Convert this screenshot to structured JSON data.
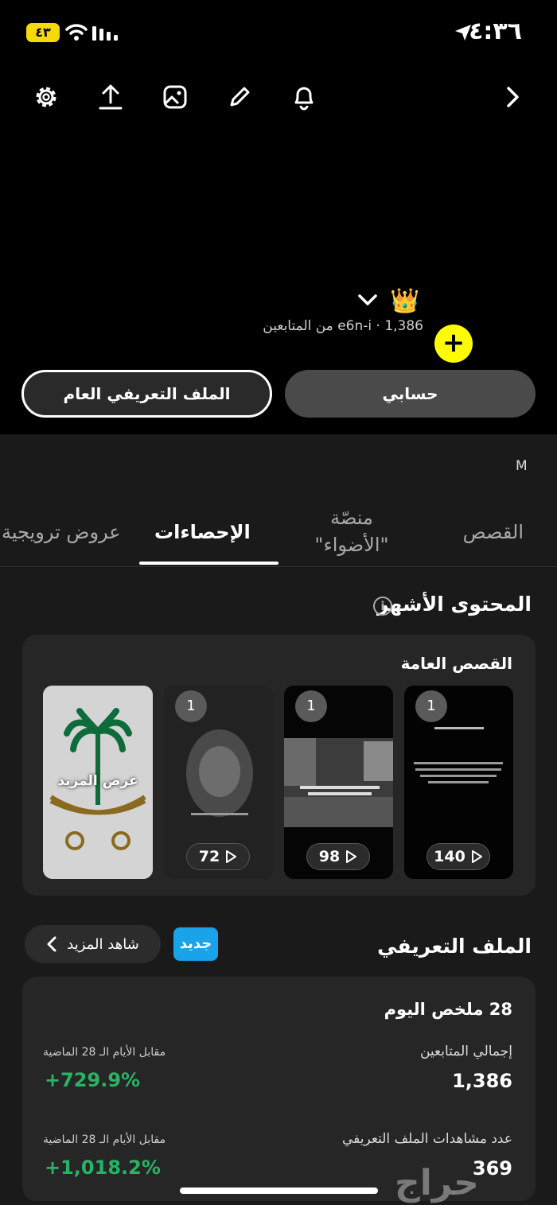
{
  "status_bar": {
    "time": "٤:٣٦",
    "battery": "٤٣"
  },
  "profile": {
    "crown_emoji": "👑",
    "handle_line": "e6n-i · 1,386 من المتابعين",
    "add_symbol": "+"
  },
  "buttons": {
    "public_profile": "الملف التعريفي العام",
    "my_account": "حسابي"
  },
  "tabs_row": {
    "m_label": "M",
    "tabs": [
      {
        "label": "القصص"
      },
      {
        "label": "منصّة \"الأضواء\""
      },
      {
        "label": "الإحصاءات"
      },
      {
        "label": "عروض ترويجية"
      }
    ]
  },
  "top_content": {
    "title": "المحتوى الأشهر",
    "info_glyph": "i",
    "card_title": "القصص العامة",
    "stories": [
      {
        "count": "1",
        "views": "140"
      },
      {
        "count": "1",
        "views": "98"
      },
      {
        "count": "1",
        "views": "72"
      }
    ],
    "see_more_label": "عرض المزيد"
  },
  "profile_section": {
    "title": "الملف التعريفي",
    "new_badge": "جديد",
    "see_more": "شاهد المزيد",
    "summary_title": "28 ملخص اليوم",
    "stats": [
      {
        "label": "إجمالي المتابعين",
        "value": "1,386",
        "compare_label": "مقابل الأيام الـ 28 الماضية",
        "change": "+729.9%"
      },
      {
        "label": "عدد مشاهدات الملف التعريفي",
        "value": "369",
        "compare_label": "مقابل الأيام الـ 28 الماضية",
        "change": "+1,018.2%"
      }
    ]
  },
  "watermark": "حراج",
  "colors": {
    "accent_yellow": "#fffc00",
    "badge_blue": "#1aa3e8",
    "positive_green": "#28b463"
  }
}
